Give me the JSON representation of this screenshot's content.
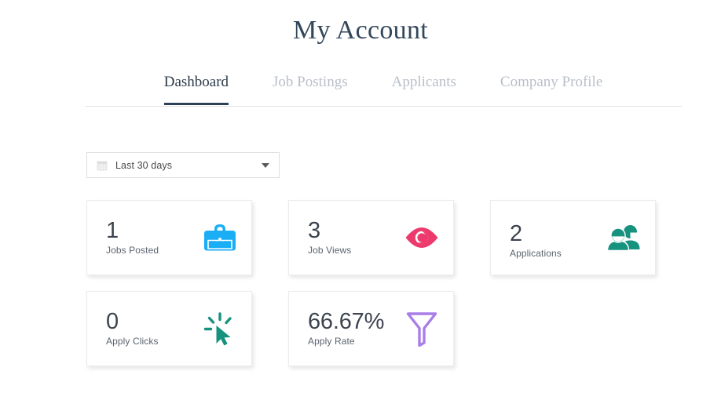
{
  "header": {
    "title": "My Account"
  },
  "tabs": [
    {
      "label": "Dashboard",
      "active": true
    },
    {
      "label": "Job Postings",
      "active": false
    },
    {
      "label": "Applicants",
      "active": false
    },
    {
      "label": "Company Profile",
      "active": false
    }
  ],
  "filter": {
    "icon": "calendar-icon",
    "value": "Last 30 days",
    "caret_icon": "chevron-down-icon"
  },
  "stats": [
    {
      "value": "1",
      "label": "Jobs Posted",
      "icon": "briefcase-icon",
      "color": "#1BAEF5"
    },
    {
      "value": "3",
      "label": "Job Views",
      "icon": "eye-icon",
      "color": "#ED3A6C"
    },
    {
      "value": "2",
      "label": "Applications",
      "icon": "people-icon",
      "color": "#17927F"
    },
    {
      "value": "0",
      "label": "Apply Clicks",
      "icon": "cursor-click-icon",
      "color": "#17927F"
    },
    {
      "value": "66.67%",
      "label": "Apply Rate",
      "icon": "funnel-icon",
      "color": "#A97EE8"
    }
  ],
  "colors": {
    "title": "#33475b",
    "tab_active": "#2b3a4a",
    "tab_inactive": "#b9bfc9",
    "tab_underline": "#2e4055",
    "card_border": "#ececec",
    "background": "#ffffff"
  }
}
